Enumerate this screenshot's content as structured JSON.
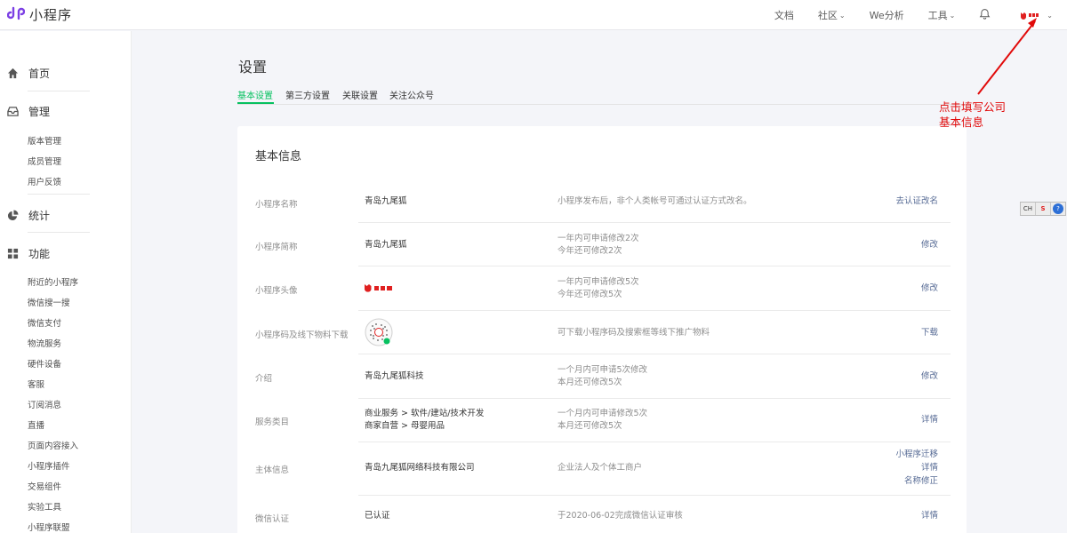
{
  "app": {
    "title": "小程序",
    "brand_color": "#7b3fe4",
    "accent_color": "#07c160",
    "link_color": "#576b95"
  },
  "topnav": {
    "docs": "文档",
    "community": "社区",
    "we_analytics": "We分析",
    "tools": "工具",
    "bell_icon": "bell-icon",
    "account_icon": "nine-tail-fox-logo"
  },
  "sidebar": {
    "home": "首页",
    "manage": "管理",
    "manage_items": [
      "版本管理",
      "成员管理",
      "用户反馈"
    ],
    "stats": "统计",
    "features": "功能",
    "feature_items": [
      "附近的小程序",
      "微信搜一搜",
      "微信支付",
      "物流服务",
      "硬件设备",
      "客服",
      "订阅消息",
      "直播",
      "页面内容接入",
      "小程序插件",
      "交易组件",
      "实验工具",
      "小程序联盟"
    ]
  },
  "page": {
    "title": "设置",
    "tabs": [
      "基本设置",
      "第三方设置",
      "关联设置",
      "关注公众号"
    ],
    "active_tab": 0
  },
  "card": {
    "title": "基本信息",
    "rows": [
      {
        "label": "小程序名称",
        "value": [
          "青岛九尾狐"
        ],
        "note": [
          "小程序发布后，非个人类帐号可通过认证方式改名。"
        ],
        "actions": [
          "去认证改名"
        ]
      },
      {
        "label": "小程序简称",
        "value": [
          "青岛九尾狐"
        ],
        "note": [
          "一年内可申请修改2次",
          "今年还可修改2次"
        ],
        "actions": [
          "修改"
        ]
      },
      {
        "label": "小程序头像",
        "value": [],
        "note": [
          "一年内可申请修改5次",
          "今年还可修改5次"
        ],
        "actions": [
          "修改"
        ]
      },
      {
        "label": "小程序码及线下物料下载",
        "value": [],
        "note": [
          "可下载小程序码及搜索框等线下推广物料"
        ],
        "actions": [
          "下载"
        ]
      },
      {
        "label": "介绍",
        "value": [
          "青岛九尾狐科技"
        ],
        "note": [
          "一个月内可申请5次修改",
          "本月还可修改5次"
        ],
        "actions": [
          "修改"
        ]
      },
      {
        "label": "服务类目",
        "value": [
          "商业服务 > 软件/建站/技术开发",
          "商家自营 > 母婴用品"
        ],
        "note": [
          "一个月内可申请修改5次",
          "本月还可修改5次"
        ],
        "actions": [
          "详情"
        ]
      },
      {
        "label": "主体信息",
        "value": [
          "青岛九尾狐网络科技有限公司"
        ],
        "note": [
          "企业法人及个体工商户"
        ],
        "actions": [
          "小程序迁移",
          "详情",
          "名称修正"
        ]
      },
      {
        "label": "微信认证",
        "value": [
          "已认证"
        ],
        "note": [
          "于2020-06-02完成微信认证审核"
        ],
        "actions": [
          "详情"
        ]
      }
    ]
  },
  "annotation": {
    "lines": [
      "点击填写公司",
      "基本信息"
    ],
    "color": "#e10a0a"
  },
  "float_toolbar": [
    "CH",
    "S",
    "?"
  ]
}
